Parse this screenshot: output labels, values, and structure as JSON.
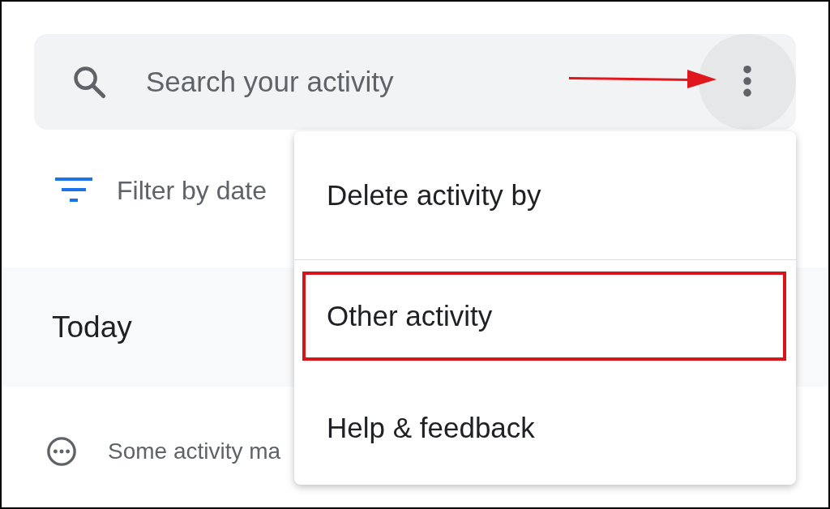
{
  "search": {
    "placeholder": "Search your activity"
  },
  "filter": {
    "label": "Filter by date"
  },
  "section": {
    "title": "Today"
  },
  "notice": {
    "text": "Some activity ma"
  },
  "menu": {
    "items": [
      {
        "label": "Delete activity by",
        "highlighted": false
      },
      {
        "label": "Other activity",
        "highlighted": true
      },
      {
        "label": "Help & feedback",
        "highlighted": false
      }
    ]
  },
  "pointer_arrow": true
}
